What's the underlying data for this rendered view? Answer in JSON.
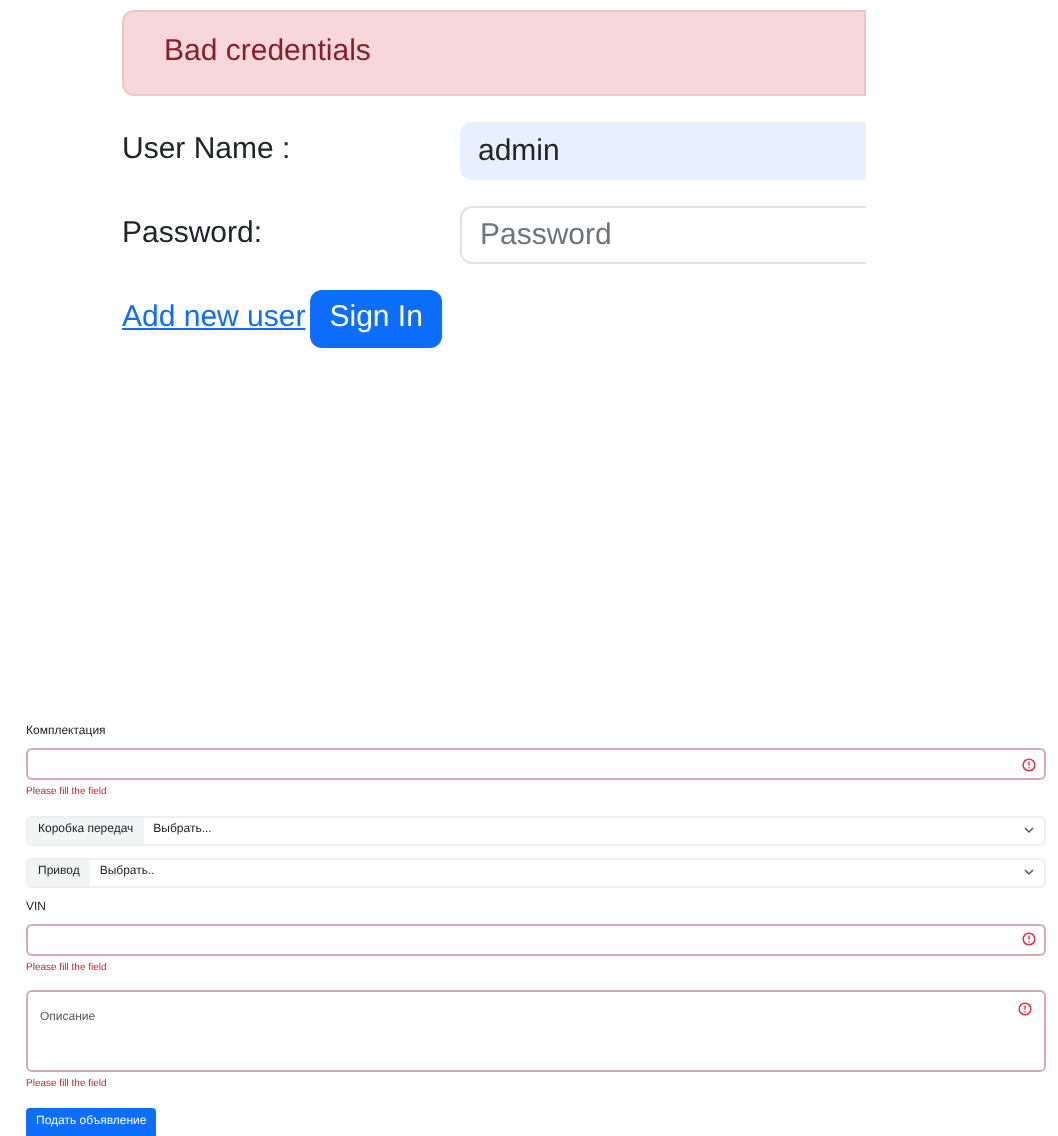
{
  "login": {
    "alert": "Bad credentials",
    "fields": [
      {
        "label": "User Name :",
        "value": "admin",
        "autofilled": true
      },
      {
        "label": "Password:",
        "placeholder": "Password",
        "autofilled": false
      }
    ],
    "link": "Add new user",
    "button": "Sign In"
  },
  "listing_form": {
    "fields": [
      {
        "kind": "input",
        "label": "Комплектация",
        "invalid": true,
        "error": "Please fill the field"
      },
      {
        "kind": "select",
        "addon": "Коробка передач",
        "value": "Выбрать..."
      },
      {
        "kind": "select",
        "addon": "Привод",
        "value": "Выбрать.."
      },
      {
        "kind": "input",
        "label": "VIN",
        "invalid": true,
        "error": "Please fill the field"
      },
      {
        "kind": "textarea",
        "placeholder": "Описание",
        "invalid": true,
        "error": "Please fill the field"
      }
    ],
    "submit": "Подать объявление"
  }
}
